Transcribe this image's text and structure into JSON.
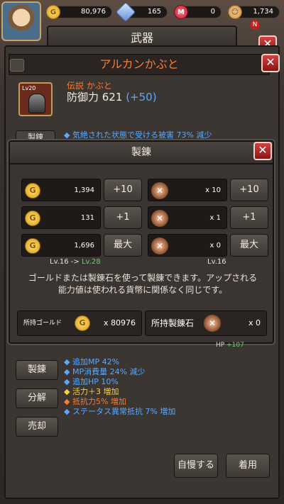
{
  "topbar": {
    "gold": "80,976",
    "gems": "165",
    "medal": "0",
    "points": "1,734",
    "notification_badge": "N"
  },
  "weapon_window": {
    "title": "武器",
    "item_name": "アルカンかぶと",
    "item_level": "Lv20",
    "rarity": "伝説 かぶと",
    "defense_label": "防御力 621",
    "defense_bonus": "(+50)",
    "bg_partial_button": "製錬",
    "bg_partial_line": "◆ 気絶された状態で受ける被害 73% 減少",
    "bg_hp_label": "HP",
    "bg_hp_value": "+107"
  },
  "refine_dialog": {
    "title": "製錬",
    "rows": [
      {
        "gold_cost": "1,394",
        "gold_button": "+10",
        "stone_cost": "x 10",
        "stone_button": "+10"
      },
      {
        "gold_cost": "131",
        "gold_button": "+1",
        "stone_cost": "x 1",
        "stone_button": "+1"
      },
      {
        "gold_cost": "1,696",
        "gold_button": "最大",
        "stone_cost": "x 0",
        "stone_button": "最大"
      }
    ],
    "left_level_from": "Lv.16 ->",
    "left_level_to": "Lv.28",
    "right_level": "Lv.16",
    "description": "ゴールドまたは製錬石を使って製錬できます。アップされる能力値は使われる貨幣に関係なく同じです。",
    "owned_gold_label": "所持ゴールド",
    "owned_gold_count": "x 80976",
    "owned_stone_label": "所持製錬石",
    "owned_stone_count": "x 0"
  },
  "side_buttons": {
    "refine": "製錬",
    "disassemble": "分解",
    "sell": "売却"
  },
  "stats": [
    {
      "text": "◆ 追加MP 42%",
      "color": "blue"
    },
    {
      "text": "◆ MP消費量 24% 減少",
      "color": "blue"
    },
    {
      "text": "◆ 追加HP 10%",
      "color": "blue"
    },
    {
      "text": "◆ 活力＋3 増加",
      "color": "yellow"
    },
    {
      "text": "◆ 抵抗力5% 増加",
      "color": "orange"
    },
    {
      "text": "◆ ステータス異常抵抗 7% 増加",
      "color": "blue"
    }
  ],
  "actions": {
    "brag": "自慢する",
    "equip": "着用"
  },
  "colors": {
    "accent_orange": "#ff7a2c",
    "stat_blue": "#5aa8ff",
    "stat_yellow": "#ffd23a",
    "level_green": "#6ad06a",
    "close_red": "#c02020"
  }
}
